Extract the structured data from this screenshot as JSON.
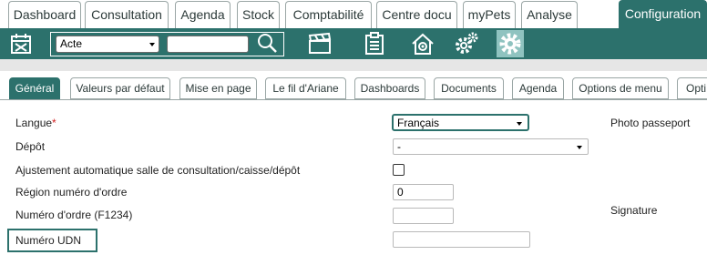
{
  "top_tabs": [
    {
      "label": "Dashboard"
    },
    {
      "label": "Consultation"
    },
    {
      "label": "Agenda"
    },
    {
      "label": "Stock"
    },
    {
      "label": "Comptabilité"
    },
    {
      "label": "Centre docu"
    },
    {
      "label": "myPets"
    },
    {
      "label": "Analyse"
    },
    {
      "label": "Configuration",
      "active": true
    }
  ],
  "toolbar": {
    "select_value": "Acte",
    "search_value": "",
    "icons": [
      "calendar-icon",
      "search-icon",
      "clapperboard-icon",
      "clipboard-icon",
      "house-gear-icon",
      "gears-icon",
      "settings-gear-icon"
    ]
  },
  "sub_tabs": [
    {
      "label": "Général",
      "active": true
    },
    {
      "label": "Valeurs par défaut"
    },
    {
      "label": "Mise en page"
    },
    {
      "label": "Le fil d'Ariane"
    },
    {
      "label": "Dashboards"
    },
    {
      "label": "Documents"
    },
    {
      "label": "Agenda"
    },
    {
      "label": "Options de menu"
    },
    {
      "label": "Opti"
    }
  ],
  "form": {
    "langue_label": "Langue",
    "langue_required": "*",
    "langue_value": "Français",
    "depot_label": "Dépôt",
    "depot_value": "-",
    "ajustement_label": "Ajustement automatique salle de consultation/caisse/dépôt",
    "ajustement_checked": false,
    "region_label": "Région numéro d'ordre",
    "region_value": "0",
    "numero_ordre_label": "Numéro d'ordre (F1234)",
    "numero_ordre_value": "",
    "udn_label": "Numéro UDN",
    "udn_value": "",
    "photo_label": "Photo passeport",
    "signature_label": "Signature"
  },
  "colors": {
    "accent": "#2c716c",
    "band": "#e6e6e6",
    "selected_icon_bg": "#8fc3c0"
  }
}
